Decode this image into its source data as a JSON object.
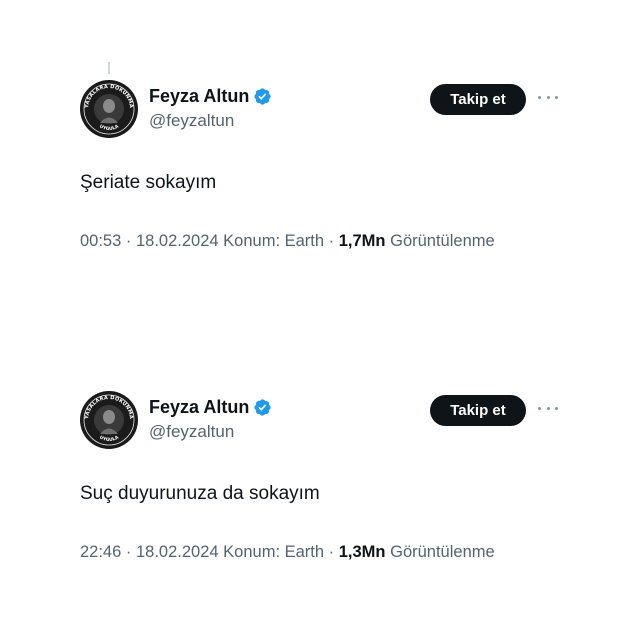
{
  "tweets": [
    {
      "author": {
        "name": "Feyza Altun",
        "handle": "@feyzaltun",
        "verified": true,
        "avatar_ring_top": "YASALARA DOKUNMA",
        "avatar_ring_bottom": "UYGULA"
      },
      "follow_label": "Takip et",
      "text": "Şeriate sokayım",
      "time": "00:53",
      "date": "18.02.2024",
      "location": "Konum: Earth",
      "views": "1,7Mn",
      "views_label": "Görüntülenme",
      "separator": "·"
    },
    {
      "author": {
        "name": "Feyza Altun",
        "handle": "@feyzaltun",
        "verified": true,
        "avatar_ring_top": "YASALARA DOKUNMA",
        "avatar_ring_bottom": "UYGULA"
      },
      "follow_label": "Takip et",
      "text": "Suç duyurunuza da sokayım",
      "time": "22:46",
      "date": "18.02.2024",
      "location": "Konum: Earth",
      "views": "1,3Mn",
      "views_label": "Görüntülenme",
      "separator": "·"
    }
  ],
  "colors": {
    "text": "#0f1419",
    "secondary": "#536471",
    "verified": "#1d9bf0",
    "button_bg": "#0f1419"
  },
  "icons": {
    "verified": "verified-badge-icon",
    "more": "more-horizontal-icon"
  }
}
